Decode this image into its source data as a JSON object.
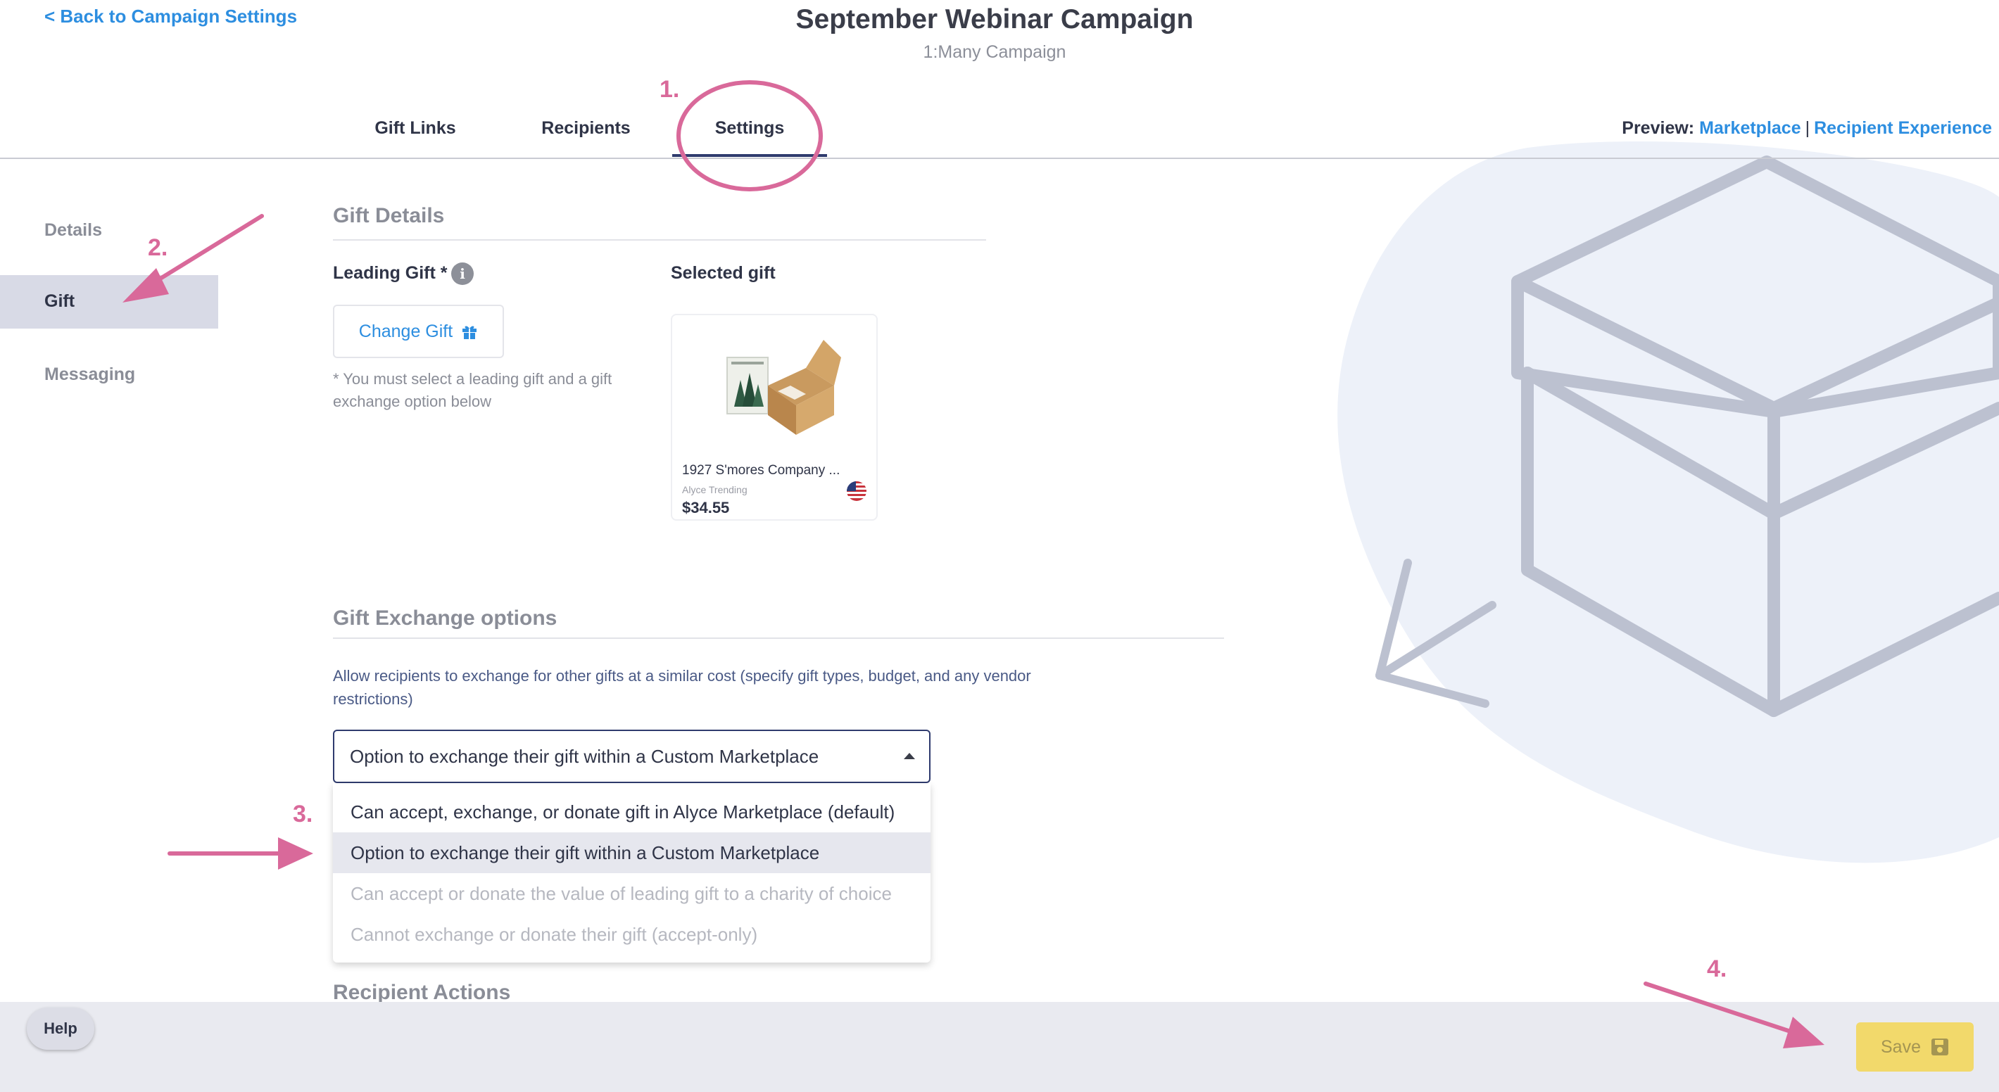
{
  "header": {
    "back_link": "< Back to Campaign Settings",
    "title": "September Webinar Campaign",
    "subtitle": "1:Many Campaign",
    "tabs": [
      {
        "label": "Gift Links",
        "active": false
      },
      {
        "label": "Recipients",
        "active": false
      },
      {
        "label": "Settings",
        "active": true
      }
    ],
    "preview": {
      "label": "Preview:",
      "marketplace": "Marketplace",
      "separator": "|",
      "recipient_experience": "Recipient Experience"
    }
  },
  "sidebar": {
    "items": [
      {
        "label": "Details",
        "active": false
      },
      {
        "label": "Gift",
        "active": true
      },
      {
        "label": "Messaging",
        "active": false
      }
    ]
  },
  "gift_details": {
    "title": "Gift Details",
    "leading_gift_label": "Leading Gift *",
    "selected_gift_label": "Selected gift",
    "change_gift_button": "Change Gift",
    "note": "* You must select a leading gift and a gift exchange option below",
    "gift": {
      "name": "1927 S'mores Company ...",
      "brand": "Alyce Trending",
      "price": "$34.55",
      "flag": "us-flag-icon"
    }
  },
  "gift_exchange": {
    "title": "Gift Exchange options",
    "description": "Allow recipients to exchange for other gifts at a similar cost (specify gift types, budget, and any vendor restrictions)",
    "selected": "Option to exchange their gift within a Custom Marketplace",
    "options": [
      {
        "label": "Can accept, exchange, or donate gift in Alyce Marketplace (default)",
        "disabled": false
      },
      {
        "label": "Option to exchange their gift within a Custom Marketplace",
        "disabled": false,
        "highlighted": true
      },
      {
        "label": "Can accept or donate the value of leading gift to a charity of choice",
        "disabled": true
      },
      {
        "label": "Cannot exchange or donate their gift (accept-only)",
        "disabled": true
      }
    ]
  },
  "recipient_actions": {
    "title": "Recipient Actions"
  },
  "footer": {
    "help": "Help",
    "save": "Save"
  },
  "annotations": {
    "step_1": "1.",
    "step_2": "2.",
    "step_3": "3.",
    "step_4": "4."
  },
  "colors": {
    "accent_link": "#2d8ee0",
    "nav_dark": "#2f3b6e",
    "annotation_pink": "#d9699a",
    "save_yellow": "#f2d96b",
    "sidebar_active_bg": "#d8dae6"
  }
}
